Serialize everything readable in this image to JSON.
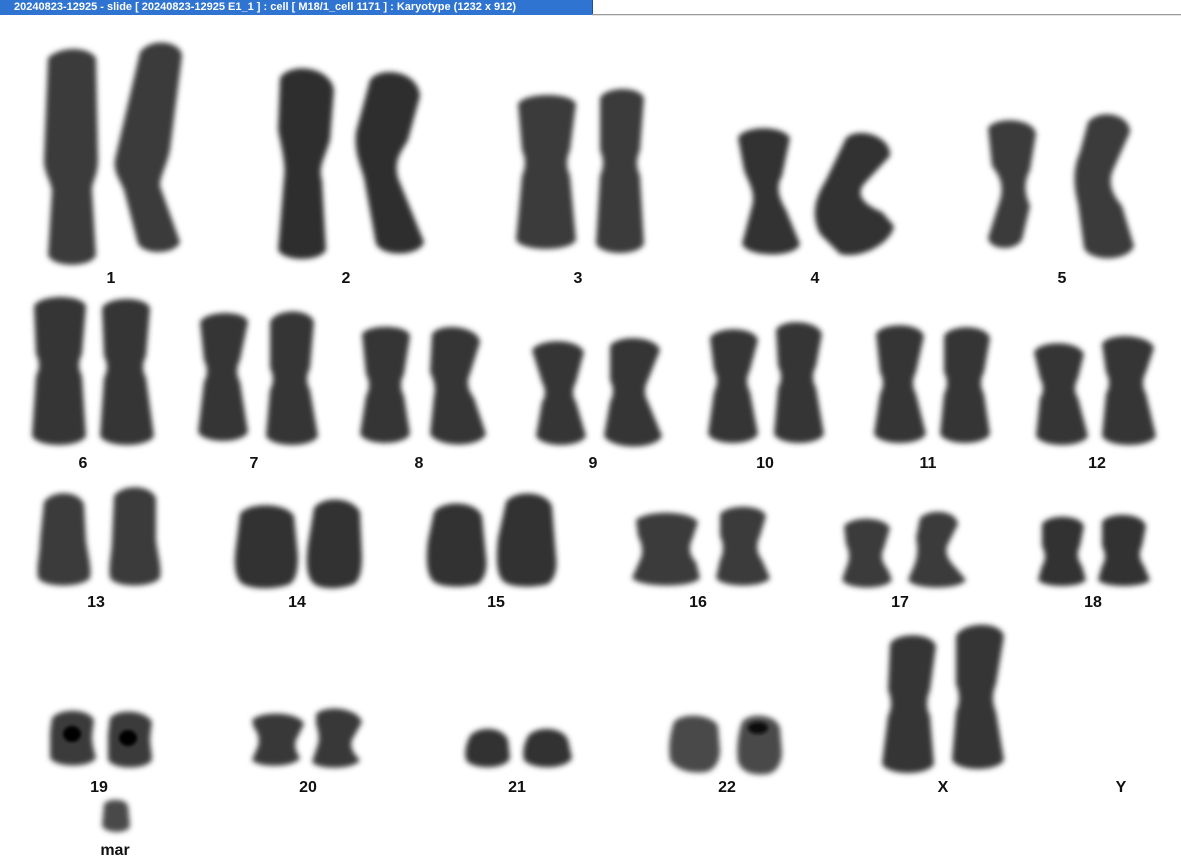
{
  "window": {
    "title": "20240823-12925 - slide [ 20240823-12925 E1_1 ] : cell [ M18/1_cell 1171 ] : Karyotype  (1232 x 912)"
  },
  "karyotype": {
    "labels": {
      "c1": "1",
      "c2": "2",
      "c3": "3",
      "c4": "4",
      "c5": "5",
      "c6": "6",
      "c7": "7",
      "c8": "8",
      "c9": "9",
      "c10": "10",
      "c11": "11",
      "c12": "12",
      "c13": "13",
      "c14": "14",
      "c15": "15",
      "c16": "16",
      "c17": "17",
      "c18": "18",
      "c19": "19",
      "c20": "20",
      "c21": "21",
      "c22": "22",
      "cX": "X",
      "cY": "Y",
      "mar": "mar"
    }
  },
  "colors": {
    "titlebar": "#2f74d0",
    "title_text": "#ffffff",
    "background": "#ffffff",
    "chromosome": "#2a2a2a"
  }
}
